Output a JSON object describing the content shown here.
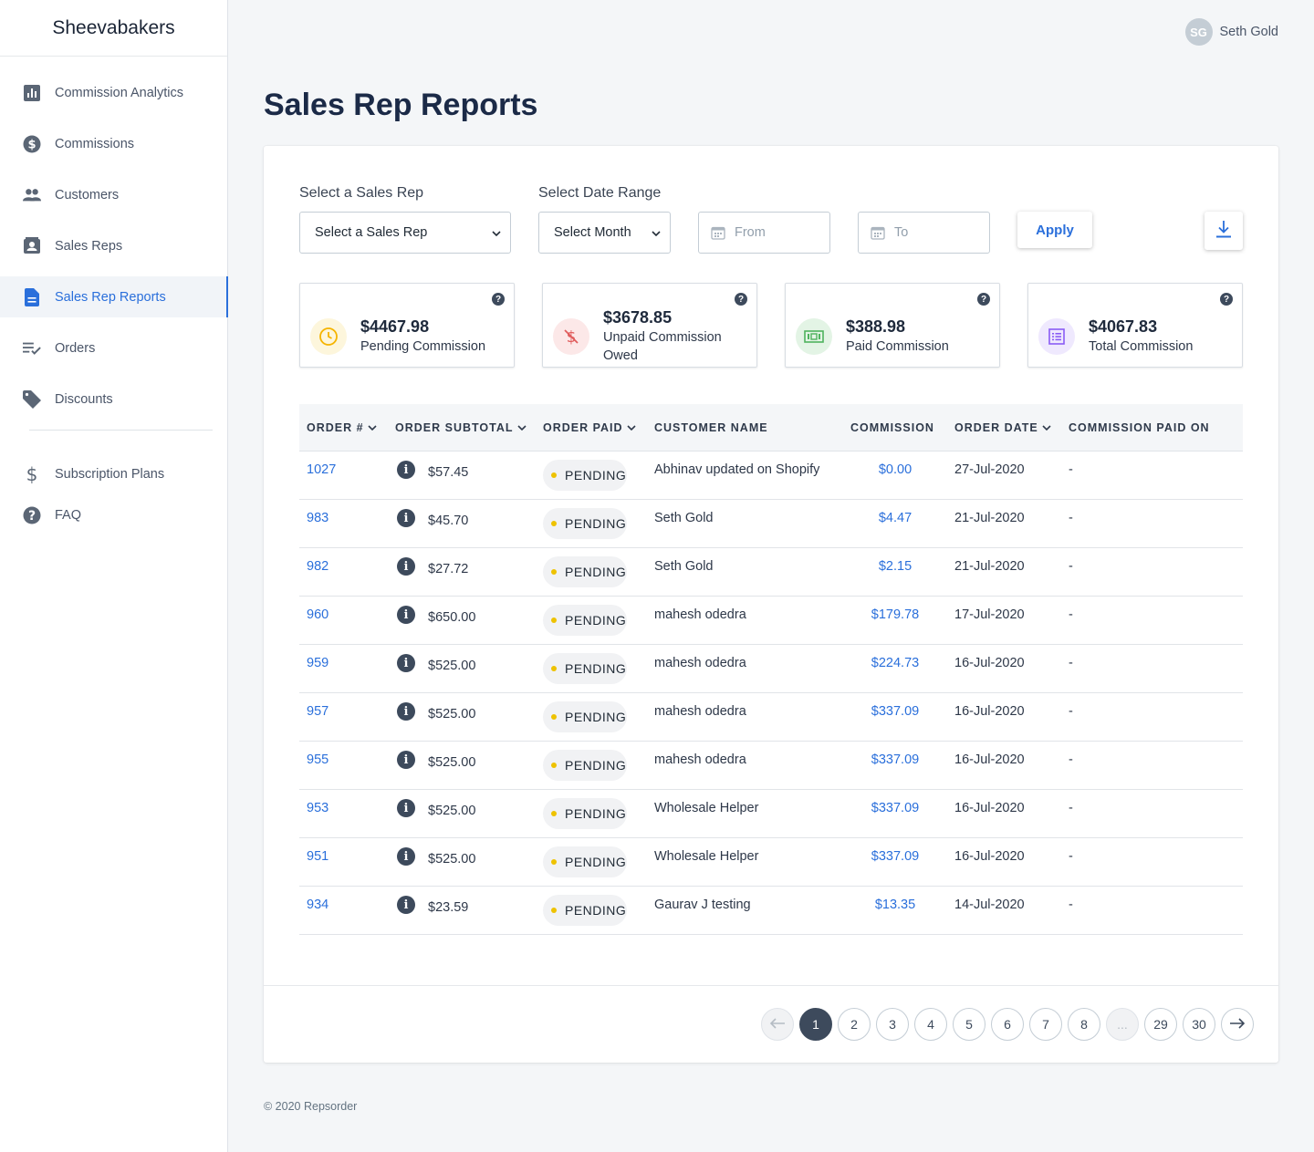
{
  "app": {
    "brand": "Sheevabakers"
  },
  "user": {
    "initials": "SG",
    "name": "Seth Gold"
  },
  "sidebar": {
    "items": [
      {
        "label": "Commission Analytics",
        "icon": "bar-chart-icon",
        "active": false
      },
      {
        "label": "Commissions",
        "icon": "dollar-circle-icon",
        "active": false
      },
      {
        "label": "Customers",
        "icon": "people-icon",
        "active": false
      },
      {
        "label": "Sales Reps",
        "icon": "contact-card-icon",
        "active": false
      },
      {
        "label": "Sales Rep Reports",
        "icon": "document-icon",
        "active": true
      },
      {
        "label": "Orders",
        "icon": "checklist-icon",
        "active": false
      },
      {
        "label": "Discounts",
        "icon": "tag-icon",
        "active": false
      }
    ],
    "secondary": [
      {
        "label": "Subscription Plans",
        "icon": "dollar-icon"
      },
      {
        "label": "FAQ",
        "icon": "help-circle-icon"
      }
    ]
  },
  "page": {
    "title": "Sales Rep Reports"
  },
  "filters": {
    "rep_label": "Select a Sales Rep",
    "rep_value": "Select a Sales Rep",
    "date_label": "Select Date Range",
    "month_value": "Select Month",
    "from_placeholder": "From",
    "to_placeholder": "To",
    "apply_label": "Apply"
  },
  "stats": [
    {
      "value": "$4467.98",
      "label": "Pending Commission",
      "icon": "clock-icon",
      "color": "#f5b400",
      "bg": "#fdf6dc"
    },
    {
      "value": "$3678.85",
      "label": "Unpaid Commission Owed",
      "icon": "no-dollar-icon",
      "color": "#e05c5c",
      "bg": "#fce8e8"
    },
    {
      "value": "$388.98",
      "label": "Paid Commission",
      "icon": "cash-icon",
      "color": "#4fb35e",
      "bg": "#e3f4e5"
    },
    {
      "value": "$4067.83",
      "label": "Total Commission",
      "icon": "list-icon",
      "color": "#8a5cf5",
      "bg": "#efe9fe"
    }
  ],
  "table": {
    "headers": [
      "ORDER #",
      "ORDER SUBTOTAL",
      "ORDER PAID",
      "CUSTOMER NAME",
      "COMMISSION",
      "ORDER DATE",
      "COMMISSION PAID ON"
    ],
    "rows": [
      {
        "order": "1027",
        "subtotal": "$57.45",
        "paid": "PENDING",
        "customer": "Abhinav updated on Shopify",
        "commission": "$0.00",
        "date": "27-Jul-2020",
        "paid_on": "-"
      },
      {
        "order": "983",
        "subtotal": "$45.70",
        "paid": "PENDING",
        "customer": "Seth Gold",
        "commission": "$4.47",
        "date": "21-Jul-2020",
        "paid_on": "-"
      },
      {
        "order": "982",
        "subtotal": "$27.72",
        "paid": "PENDING",
        "customer": "Seth Gold",
        "commission": "$2.15",
        "date": "21-Jul-2020",
        "paid_on": "-"
      },
      {
        "order": "960",
        "subtotal": "$650.00",
        "paid": "PENDING",
        "customer": "mahesh odedra",
        "commission": "$179.78",
        "date": "17-Jul-2020",
        "paid_on": "-"
      },
      {
        "order": "959",
        "subtotal": "$525.00",
        "paid": "PENDING",
        "customer": "mahesh odedra",
        "commission": "$224.73",
        "date": "16-Jul-2020",
        "paid_on": "-"
      },
      {
        "order": "957",
        "subtotal": "$525.00",
        "paid": "PENDING",
        "customer": "mahesh odedra",
        "commission": "$337.09",
        "date": "16-Jul-2020",
        "paid_on": "-"
      },
      {
        "order": "955",
        "subtotal": "$525.00",
        "paid": "PENDING",
        "customer": "mahesh odedra",
        "commission": "$337.09",
        "date": "16-Jul-2020",
        "paid_on": "-"
      },
      {
        "order": "953",
        "subtotal": "$525.00",
        "paid": "PENDING",
        "customer": "Wholesale Helper",
        "commission": "$337.09",
        "date": "16-Jul-2020",
        "paid_on": "-"
      },
      {
        "order": "951",
        "subtotal": "$525.00",
        "paid": "PENDING",
        "customer": "Wholesale Helper",
        "commission": "$337.09",
        "date": "16-Jul-2020",
        "paid_on": "-"
      },
      {
        "order": "934",
        "subtotal": "$23.59",
        "paid": "PENDING",
        "customer": "Gaurav J testing",
        "commission": "$13.35",
        "date": "14-Jul-2020",
        "paid_on": "-"
      }
    ]
  },
  "pagination": {
    "pages": [
      "1",
      "2",
      "3",
      "4",
      "5",
      "6",
      "7",
      "8",
      "...",
      "29",
      "30"
    ],
    "current": "1"
  },
  "footer": {
    "text": "© 2020 Repsorder"
  }
}
